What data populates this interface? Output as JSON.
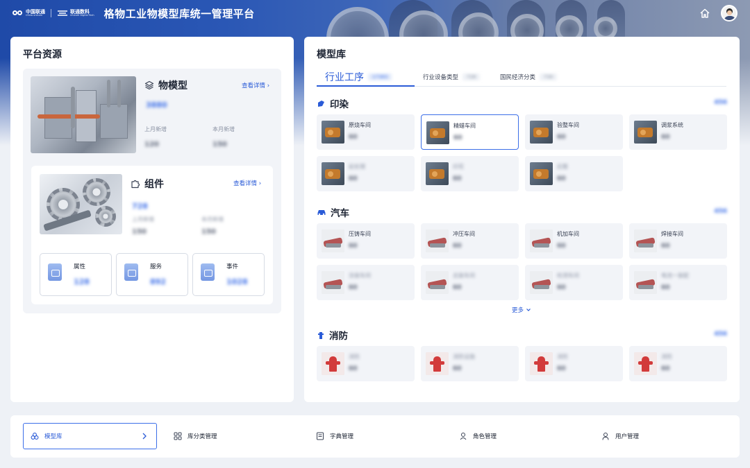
{
  "header": {
    "logo1": {
      "cn": "中国联通",
      "en": "China unicom"
    },
    "logo2": {
      "cn": "联通数科",
      "en": "Unicom Digital Tech"
    },
    "app_title": "格物工业物模型库统一管理平台",
    "icons": [
      "home-icon",
      "avatar"
    ]
  },
  "left": {
    "title": "平台资源",
    "thing_model": {
      "label": "物模型",
      "detail_link": "查看详情",
      "count": "3880",
      "stats": [
        {
          "label": "上月新增",
          "value": "120"
        },
        {
          "label": "本月新增",
          "value": "150"
        }
      ]
    },
    "component": {
      "label": "组件",
      "detail_link": "查看详情",
      "count": "728",
      "stats": [
        {
          "label": "上月新增",
          "value": "150"
        },
        {
          "label": "本月新增",
          "value": "150"
        }
      ],
      "sub": [
        {
          "label": "属性",
          "value": "128"
        },
        {
          "label": "服务",
          "value": "892"
        },
        {
          "label": "事件",
          "value": "1028"
        }
      ]
    }
  },
  "right": {
    "title": "模型库",
    "tabs": [
      {
        "label": "行业工序",
        "count": "17383"
      },
      {
        "label": "行业设备类型",
        "count": "728"
      },
      {
        "label": "国民经济分类",
        "count": "730"
      }
    ],
    "sections": [
      {
        "title": "印染",
        "icon": "dye-icon",
        "count": "456",
        "tiles": [
          {
            "name": "原烧车间",
            "value": "60",
            "thumb": "machine"
          },
          {
            "name": "精蜡车间",
            "value": "60",
            "thumb": "machine"
          },
          {
            "name": "验整车间",
            "value": "60",
            "thumb": "machine"
          },
          {
            "name": "调浆系统",
            "value": "60",
            "thumb": "machine"
          },
          {
            "name": "前处理",
            "value": "60",
            "thumb": "machine"
          },
          {
            "name": "印花",
            "value": "60",
            "thumb": "machine"
          },
          {
            "name": "后整",
            "value": "60",
            "thumb": "machine"
          }
        ]
      },
      {
        "title": "汽车",
        "icon": "car-icon",
        "count": "456",
        "tiles": [
          {
            "name": "压铸车间",
            "value": "60",
            "thumb": "car"
          },
          {
            "name": "冲压车间",
            "value": "60",
            "thumb": "car"
          },
          {
            "name": "机加车间",
            "value": "60",
            "thumb": "car"
          },
          {
            "name": "焊接车间",
            "value": "60",
            "thumb": "car"
          },
          {
            "name": "涂装车间",
            "value": "60",
            "thumb": "car"
          },
          {
            "name": "总装车间",
            "value": "60",
            "thumb": "car"
          },
          {
            "name": "检测车间",
            "value": "60",
            "thumb": "car"
          },
          {
            "name": "电池一装配",
            "value": "60",
            "thumb": "car"
          }
        ]
      },
      {
        "title": "消防",
        "icon": "hydrant-icon",
        "count": "456",
        "tiles": [
          {
            "name": "消防",
            "value": "60",
            "thumb": "hydrant"
          },
          {
            "name": "消防设施",
            "value": "60",
            "thumb": "hydrant"
          },
          {
            "name": "消防",
            "value": "60",
            "thumb": "hydrant"
          },
          {
            "name": "消防",
            "value": "60",
            "thumb": "hydrant"
          }
        ]
      }
    ],
    "more_label": "更多"
  },
  "bottom_nav": [
    {
      "label": "模型库",
      "icon": "model-lib-icon",
      "active": true
    },
    {
      "label": "库分类管理",
      "icon": "grid-icon",
      "active": false
    },
    {
      "label": "字典管理",
      "icon": "book-icon",
      "active": false
    },
    {
      "label": "角色管理",
      "icon": "role-icon",
      "active": false
    },
    {
      "label": "用户管理",
      "icon": "user-icon",
      "active": false
    }
  ],
  "colors": {
    "primary": "#2a5bd7",
    "header_blue": "#1f4aa8",
    "panel_bg": "#f2f4f8"
  }
}
